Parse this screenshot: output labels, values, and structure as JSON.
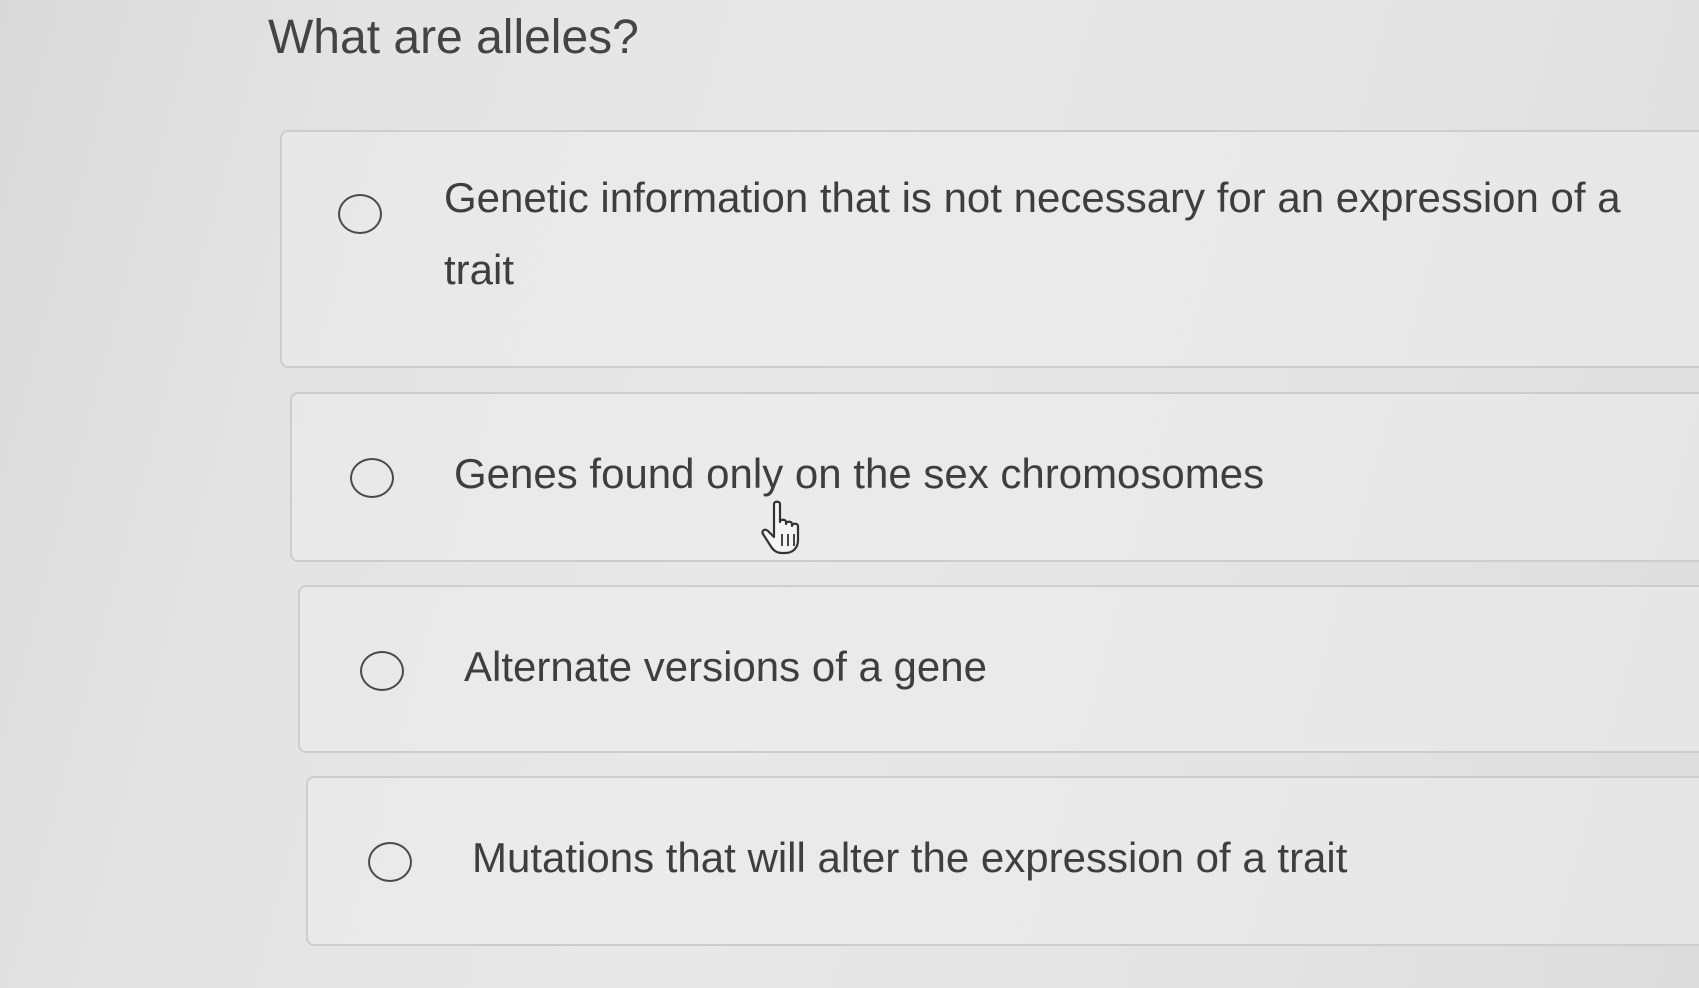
{
  "question": {
    "title": "What are alleles?"
  },
  "options": [
    {
      "label": "Genetic information that is not necessary for an expression of a trait",
      "selected": false
    },
    {
      "label": "Genes found only on the sex chromosomes",
      "selected": false
    },
    {
      "label": "Alternate versions of a gene",
      "selected": false
    },
    {
      "label": "Mutations that will alter the expression of a trait",
      "selected": false
    }
  ],
  "cursor": {
    "icon": "hand-pointer-icon"
  },
  "colors": {
    "background": "#e3e3e3",
    "text": "#3e3e3e",
    "border": "#cdcdcd"
  }
}
